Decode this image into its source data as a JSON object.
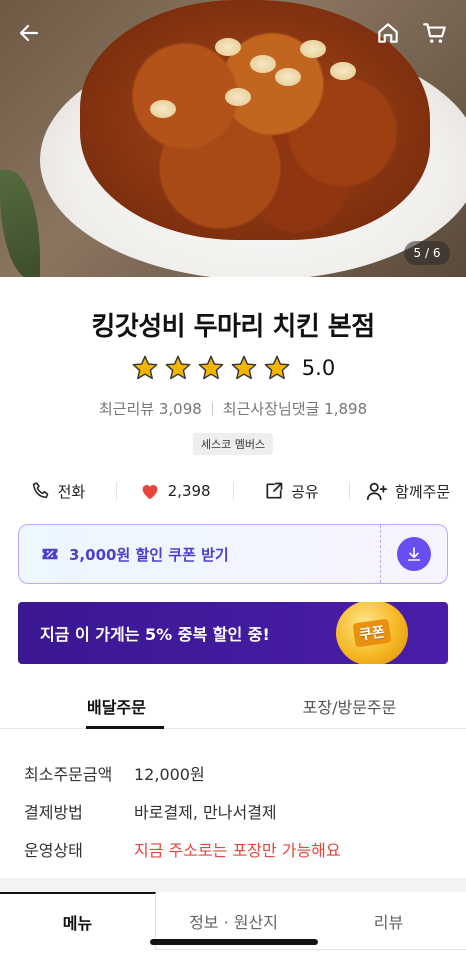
{
  "hero": {
    "counter": "5 / 6",
    "back_icon": "back-arrow-icon",
    "home_icon": "home-icon",
    "cart_icon": "cart-icon"
  },
  "store": {
    "name": "킹갓성비 두마리 치킨 본점",
    "rating": "5.0",
    "star_rating": 5,
    "star_color": "#f5b400",
    "recent_reviews": "최근리뷰 3,098",
    "owner_replies": "최근사장님댓글 1,898",
    "badge": "세스코 멤버스"
  },
  "actions": [
    {
      "label": "전화",
      "icon": "phone-icon"
    },
    {
      "label": "2,398",
      "icon": "heart-icon",
      "color": "#e8453c"
    },
    {
      "label": "공유",
      "icon": "share-icon"
    },
    {
      "label": "함께주문",
      "icon": "add-user-icon"
    }
  ],
  "coupon": {
    "label": "3,000원 할인 쿠폰 받기",
    "icon": "coupon-ticket-icon",
    "download_icon": "download-icon",
    "accent": "#6a4df0"
  },
  "banner": {
    "text": "지금 이 가게는 5% 중복 할인 중!",
    "coin_text": "쿠폰",
    "background": "#3a1793"
  },
  "order_tabs": [
    {
      "label": "배달주문",
      "active": true
    },
    {
      "label": "포장/방문주문",
      "active": false
    }
  ],
  "info": [
    {
      "key": "최소주문금액",
      "value": "12,000원"
    },
    {
      "key": "결제방법",
      "value": "바로결제, 만나서결제"
    },
    {
      "key": "운영상태",
      "value": "지금 주소로는 포장만 가능해요",
      "color": "#e8453c"
    }
  ],
  "bottom_tabs": [
    {
      "label": "메뉴",
      "active": true
    },
    {
      "label": "정보 · 원산지",
      "active": false
    },
    {
      "label": "리뷰",
      "active": false
    }
  ]
}
